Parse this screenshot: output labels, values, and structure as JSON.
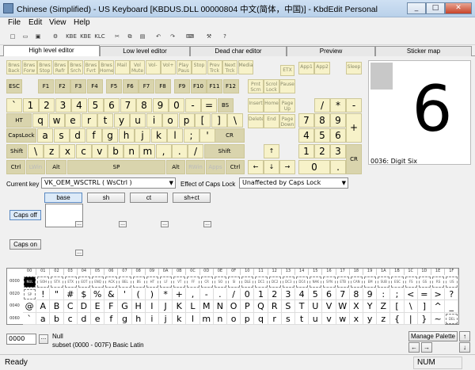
{
  "window": {
    "title": "Chinese (Simplified) - US Keyboard [KBDUS.DLL 00000804 中文(简体，中国)] - KbdEdit Personal",
    "controls": [
      "_",
      "□",
      "✕"
    ]
  },
  "menu": [
    "File",
    "Edit",
    "View",
    "Help"
  ],
  "toolbar": {
    "buttons": [
      {
        "name": "new-icon",
        "glyph": "□"
      },
      {
        "name": "open-icon",
        "glyph": "▭"
      },
      {
        "name": "save-icon",
        "glyph": "▣"
      },
      {
        "name": "settings-icon",
        "glyph": "⚙"
      },
      {
        "name": "kbe-import-icon",
        "glyph": "KBE"
      },
      {
        "name": "kbe-export-icon",
        "glyph": "KBE"
      },
      {
        "name": "klc-icon",
        "glyph": "KLC"
      },
      {
        "name": "cut-icon",
        "glyph": "✂"
      },
      {
        "name": "copy-icon",
        "glyph": "⧉"
      },
      {
        "name": "paste-icon",
        "glyph": "▤"
      },
      {
        "name": "undo-icon",
        "glyph": "↶"
      },
      {
        "name": "redo-icon",
        "glyph": "↷"
      },
      {
        "name": "keyboard-icon",
        "glyph": "⌨"
      },
      {
        "name": "tools-icon",
        "glyph": "⚒"
      },
      {
        "name": "help-icon",
        "glyph": "?"
      }
    ]
  },
  "tabs": [
    "High level editor",
    "Low level editor",
    "Dead char editor",
    "Preview",
    "Sticker map"
  ],
  "keyboard": {
    "fnrow1": [
      "Brws Back",
      "Brws Forw",
      "Brws Stop",
      "Brws Refr",
      "Brws Srch",
      "Brws Fvrt",
      "Brws Home",
      "Mail",
      "Vol Mute",
      "Vol-",
      "Vol+",
      "Play Paus",
      "Stop",
      "Prev Trck",
      "Next Trck",
      "Media"
    ],
    "fnrow2": [
      "ESC",
      "F1",
      "F2",
      "F3",
      "F4",
      "F5",
      "F6",
      "F7",
      "F8",
      "F9",
      "F10",
      "F11",
      "F12",
      "Prnt Scrn",
      "Scrol Lock",
      "Pause"
    ],
    "extra": [
      "App1",
      "App2",
      "Sleep",
      "ETX"
    ],
    "row1": [
      "`",
      "1",
      "2",
      "3",
      "4",
      "5",
      "6",
      "7",
      "8",
      "9",
      "0",
      "-",
      "=",
      "BS"
    ],
    "row2": [
      "HT",
      "q",
      "w",
      "e",
      "r",
      "t",
      "y",
      "u",
      "i",
      "o",
      "p",
      "[",
      "]",
      "\\"
    ],
    "row3": [
      "CapsLock",
      "a",
      "s",
      "d",
      "f",
      "g",
      "h",
      "j",
      "k",
      "l",
      ";",
      "'",
      "CR"
    ],
    "row4": [
      "Shift",
      "\\",
      "z",
      "x",
      "c",
      "v",
      "b",
      "n",
      "m",
      ",",
      ".",
      "/",
      "Shift"
    ],
    "row5": [
      "Ctrl",
      "LWin",
      "Alt",
      "SP",
      "Alt",
      "RWin",
      "Apps",
      "Ctrl"
    ],
    "nav": [
      "Insert",
      "Home",
      "Page Up",
      "Delete",
      "End",
      "Page Down"
    ],
    "arrows": [
      "↑",
      "←",
      "↓",
      "→"
    ],
    "numpad": [
      "/",
      "*",
      "-",
      "7",
      "8",
      "9",
      "+",
      "4",
      "5",
      "6",
      "1",
      "2",
      "3",
      "0",
      ".",
      "CR"
    ]
  },
  "preview": {
    "char": "6",
    "code": "0036: Digit Six"
  },
  "controls": {
    "current_key_label": "Current key",
    "current_key_value": "VK_OEM_WSCTRL ( WsCtrl )",
    "caps_effect_label": "Effect of Caps Lock",
    "caps_effect_value": "Unaffected by Caps Lock",
    "shift_states": [
      "base",
      "sh",
      "ct",
      "sh+ct"
    ],
    "caps_off": "Caps off",
    "caps_on": "Caps on"
  },
  "charmap": {
    "headers": [
      "00",
      "01",
      "02",
      "03",
      "04",
      "05",
      "06",
      "07",
      "08",
      "09",
      "0A",
      "0B",
      "0C",
      "0D",
      "0E",
      "0F",
      "10",
      "11",
      "12",
      "13",
      "14",
      "15",
      "16",
      "17",
      "18",
      "19",
      "1A",
      "1B",
      "1C",
      "1D",
      "1E",
      "1F"
    ],
    "rowlabels": [
      "0000",
      "0020",
      "0040",
      "0060"
    ],
    "row0": [
      "NUL",
      "SOH",
      "STX",
      "ETX",
      "EOT",
      "ENQ",
      "ACK",
      "BEL",
      "BS",
      "HT",
      "LF",
      "VT",
      "FF",
      "CR",
      "SO",
      "SI",
      "DLE",
      "DC1",
      "DC2",
      "DC3",
      "DC4",
      "NAK",
      "SYN",
      "ETB",
      "CAN",
      "EM",
      "SUB",
      "ESC",
      "FS",
      "GS",
      "RS",
      "US"
    ],
    "row1": [
      "SP",
      "!",
      "\"",
      "#",
      "$",
      "%",
      "&",
      "'",
      "(",
      ")",
      "*",
      "+",
      ",",
      "-",
      ".",
      "/",
      "0",
      "1",
      "2",
      "3",
      "4",
      "5",
      "6",
      "7",
      "8",
      "9",
      ":",
      ";",
      "<",
      "=",
      ">",
      "?"
    ],
    "row2": [
      "@",
      "A",
      "B",
      "C",
      "D",
      "E",
      "F",
      "G",
      "H",
      "I",
      "J",
      "K",
      "L",
      "M",
      "N",
      "O",
      "P",
      "Q",
      "R",
      "S",
      "T",
      "U",
      "V",
      "W",
      "X",
      "Y",
      "Z",
      "[",
      "\\",
      "]",
      "^",
      "_"
    ],
    "row3": [
      "`",
      "a",
      "b",
      "c",
      "d",
      "e",
      "f",
      "g",
      "h",
      "i",
      "j",
      "k",
      "l",
      "m",
      "n",
      "o",
      "p",
      "q",
      "r",
      "s",
      "t",
      "u",
      "v",
      "w",
      "x",
      "y",
      "z",
      "{",
      "|",
      "}",
      "~",
      "DEL"
    ]
  },
  "bottom": {
    "code_value": "0000",
    "char_name": "Null",
    "subset": "subset (0000 - 007F) Basic Latin",
    "manage": "Manage Palette",
    "arrows": [
      "←",
      "→",
      "↑",
      "↓"
    ]
  },
  "status": {
    "left": "Ready",
    "num": "NUM"
  }
}
